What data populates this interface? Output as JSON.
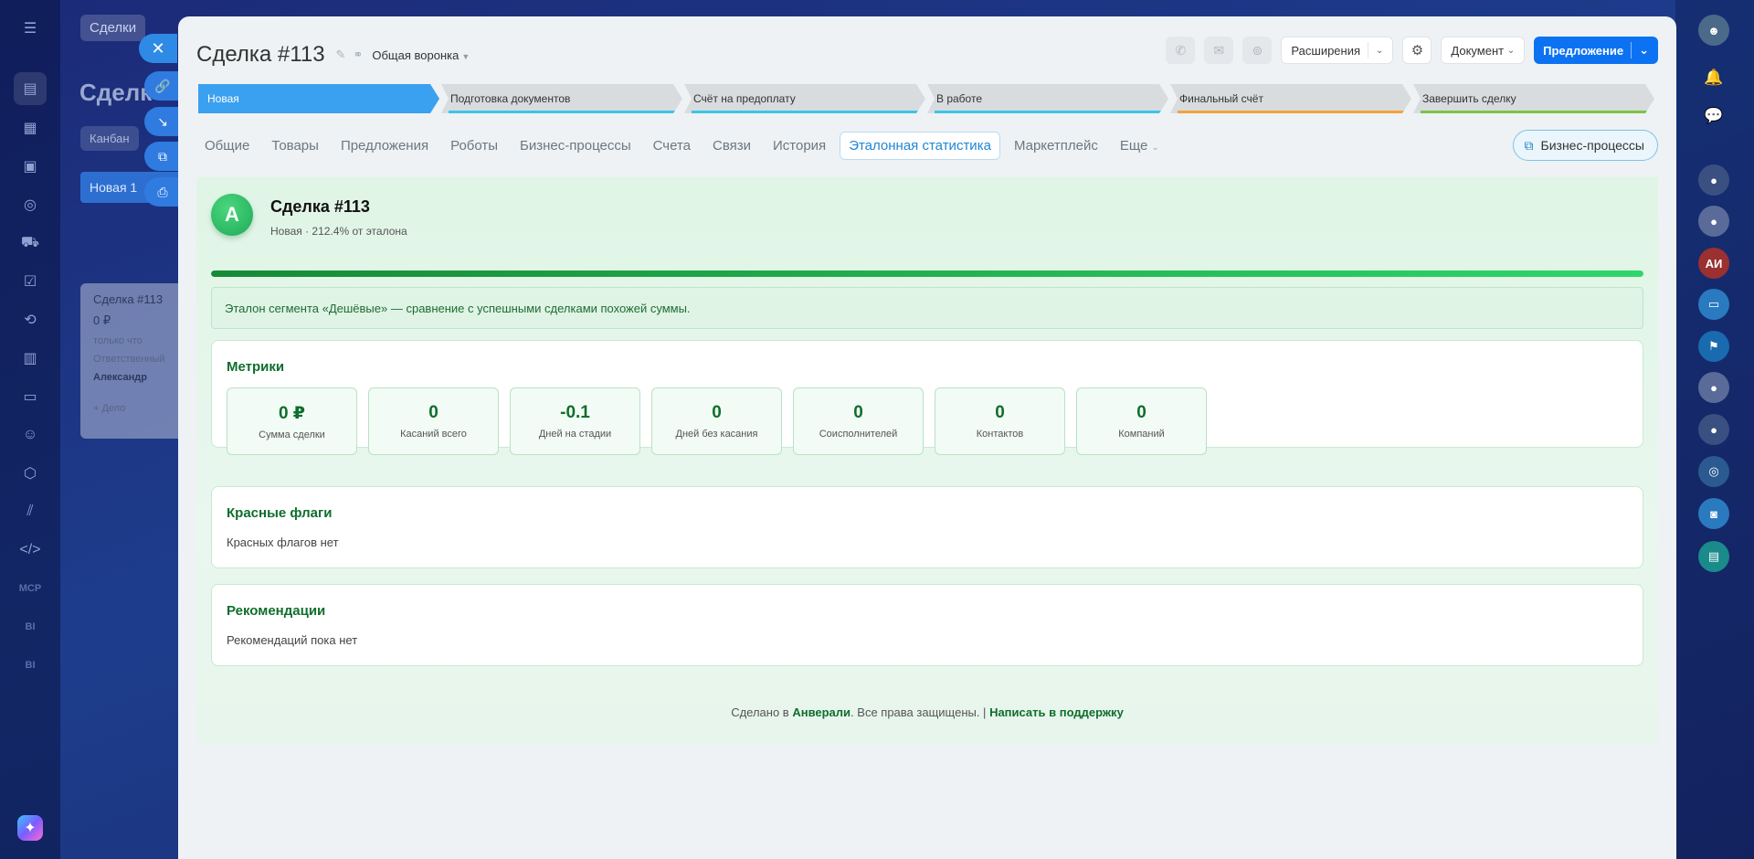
{
  "background": {
    "tab": "Сделки",
    "title": "Сделк",
    "kanban": "Канбан",
    "stage": "Новая  1",
    "card": {
      "title": "Сделка #113",
      "amount": "0 ₽",
      "time": "только что",
      "responsible_label": "Ответственный",
      "responsible": "Александр",
      "add": "+ Дело"
    }
  },
  "rail": {
    "mcp": "MCP",
    "bi": "BI"
  },
  "header": {
    "title": "Сделка #113",
    "funnel": "Общая воронка",
    "extensions": "Расширения",
    "document": "Документ",
    "proposal": "Предложение"
  },
  "stages": [
    {
      "label": "Новая",
      "active": true,
      "color": "#3aa0f0"
    },
    {
      "label": "Подготовка документов",
      "active": false,
      "color": "#3ec3e8"
    },
    {
      "label": "Счёт на предоплату",
      "active": false,
      "color": "#3ec3e8"
    },
    {
      "label": "В работе",
      "active": false,
      "color": "#3ec3e8"
    },
    {
      "label": "Финальный счёт",
      "active": false,
      "color": "#f2a33a"
    },
    {
      "label": "Завершить сделку",
      "active": false,
      "color": "#7cc343"
    }
  ],
  "tabs": [
    "Общие",
    "Товары",
    "Предложения",
    "Роботы",
    "Бизнес-процессы",
    "Счета",
    "Связи",
    "История",
    "Эталонная статистика",
    "Маркетплейс",
    "Еще"
  ],
  "active_tab": "Эталонная статистика",
  "bp_button": "Бизнес-процессы",
  "content": {
    "avatar_letter": "A",
    "title": "Сделка #113",
    "subtitle": "Новая · 212.4% от эталона",
    "progress": 1.0,
    "note": "Эталон сегмента «Дешёвые» — сравнение с успешными сделками похожей суммы.",
    "metrics_title": "Метрики",
    "metrics": [
      {
        "value": "0 ₽",
        "label": "Сумма сделки"
      },
      {
        "value": "0",
        "label": "Касаний всего"
      },
      {
        "value": "-0.1",
        "label": "Дней на стадии"
      },
      {
        "value": "0",
        "label": "Дней без касания"
      },
      {
        "value": "0",
        "label": "Соисполнителей"
      },
      {
        "value": "0",
        "label": "Контактов"
      },
      {
        "value": "0",
        "label": "Компаний"
      }
    ],
    "flags_title": "Красные флаги",
    "flags_text": "Красных флагов нет",
    "recs_title": "Рекомендации",
    "recs_text": "Рекомендаций пока нет",
    "footer": {
      "prefix": "Сделано в ",
      "brand": "Анверали",
      "middle": ". Все права защищены. | ",
      "support": "Написать в поддержку"
    }
  },
  "right_rail": {
    "avatar_initials": "АИ"
  },
  "colors": {
    "accent": "#0d72f2",
    "green": "#0f6e2c",
    "stage_active": "#3aa0f0"
  },
  "icons": [
    "menu-icon",
    "bell-icon",
    "chat-icon",
    "phone-icon",
    "mail-icon",
    "gear-icon",
    "pencil-icon",
    "link-icon",
    "close-icon",
    "print-icon"
  ]
}
